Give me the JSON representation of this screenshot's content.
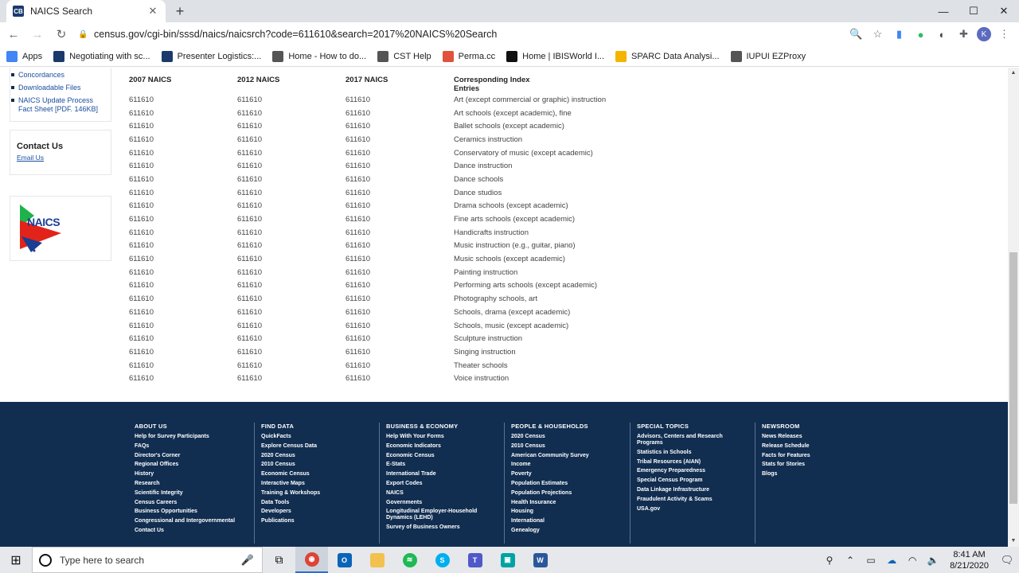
{
  "browser": {
    "tab_title": "NAICS Search",
    "tab_favicon": "CB",
    "url": "census.gov/cgi-bin/sssd/naics/naicsrch?code=611610&search=2017%20NAICS%20Search",
    "profile_initial": "K"
  },
  "bookmarks": [
    {
      "label": "Apps",
      "icon": "apps-grid-icon",
      "color": "#4285f4"
    },
    {
      "label": "Negotiating with sc...",
      "icon": "osc-icon",
      "color": "#1b3a6b"
    },
    {
      "label": "Presenter Logistics:...",
      "icon": "presenter-icon",
      "color": "#1b3a6b"
    },
    {
      "label": "Home - How to do...",
      "icon": "home-icon",
      "color": "#555555"
    },
    {
      "label": "CST Help",
      "icon": "globe-icon",
      "color": "#555555"
    },
    {
      "label": "Perma.cc",
      "icon": "perma-icon",
      "color": "#e0533a"
    },
    {
      "label": "Home | IBISWorld I...",
      "icon": "ibis-icon",
      "color": "#111111"
    },
    {
      "label": "SPARC Data Analysi...",
      "icon": "drive-icon",
      "color": "#f4b400"
    },
    {
      "label": "IUPUI EZProxy",
      "icon": "globe-icon",
      "color": "#555555"
    }
  ],
  "sidebar": {
    "links": [
      "Concordances",
      "Downloadable Files",
      "NAICS Update Process Fact Sheet [PDF. 146KB]"
    ],
    "contact_title": "Contact Us",
    "contact_link": "Email Us",
    "logo_text": "NAICS"
  },
  "table": {
    "headers": [
      "2007 NAICS",
      "2012 NAICS",
      "2017 NAICS",
      "Corresponding Index Entries"
    ],
    "rows": [
      [
        "611610",
        "611610",
        "611610",
        "Art (except commercial or graphic) instruction"
      ],
      [
        "611610",
        "611610",
        "611610",
        "Art schools (except academic), fine"
      ],
      [
        "611610",
        "611610",
        "611610",
        "Ballet schools (except academic)"
      ],
      [
        "611610",
        "611610",
        "611610",
        "Ceramics instruction"
      ],
      [
        "611610",
        "611610",
        "611610",
        "Conservatory of music (except academic)"
      ],
      [
        "611610",
        "611610",
        "611610",
        "Dance instruction"
      ],
      [
        "611610",
        "611610",
        "611610",
        "Dance schools"
      ],
      [
        "611610",
        "611610",
        "611610",
        "Dance studios"
      ],
      [
        "611610",
        "611610",
        "611610",
        "Drama schools (except academic)"
      ],
      [
        "611610",
        "611610",
        "611610",
        "Fine arts schools (except academic)"
      ],
      [
        "611610",
        "611610",
        "611610",
        "Handicrafts instruction"
      ],
      [
        "611610",
        "611610",
        "611610",
        "Music instruction (e.g., guitar, piano)"
      ],
      [
        "611610",
        "611610",
        "611610",
        "Music schools (except academic)"
      ],
      [
        "611610",
        "611610",
        "611610",
        "Painting instruction"
      ],
      [
        "611610",
        "611610",
        "611610",
        "Performing arts schools (except academic)"
      ],
      [
        "611610",
        "611610",
        "611610",
        "Photography schools, art"
      ],
      [
        "611610",
        "611610",
        "611610",
        "Schools, drama (except academic)"
      ],
      [
        "611610",
        "611610",
        "611610",
        "Schools, music (except academic)"
      ],
      [
        "611610",
        "611610",
        "611610",
        "Sculpture instruction"
      ],
      [
        "611610",
        "611610",
        "611610",
        "Singing instruction"
      ],
      [
        "611610",
        "611610",
        "611610",
        "Theater schools"
      ],
      [
        "611610",
        "611610",
        "611610",
        "Voice instruction"
      ]
    ]
  },
  "footer": {
    "columns": [
      {
        "heading": "ABOUT US",
        "links": [
          "Help for Survey Participants",
          "FAQs",
          "Director's Corner",
          "Regional Offices",
          "History",
          "Research",
          "Scientific Integrity",
          "Census Careers",
          "Business Opportunities",
          "Congressional and Intergovernmental",
          "Contact Us"
        ]
      },
      {
        "heading": "FIND DATA",
        "links": [
          "QuickFacts",
          "Explore Census Data",
          "2020 Census",
          "2010 Census",
          "Economic Census",
          "Interactive Maps",
          "Training & Workshops",
          "Data Tools",
          "Developers",
          "Publications"
        ]
      },
      {
        "heading": "BUSINESS & ECONOMY",
        "links": [
          "Help With Your Forms",
          "Economic Indicators",
          "Economic Census",
          "E-Stats",
          "International Trade",
          "Export Codes",
          "NAICS",
          "Governments",
          "Longitudinal Employer-Household Dynamics (LEHD)",
          "Survey of Business Owners"
        ]
      },
      {
        "heading": "PEOPLE & HOUSEHOLDS",
        "links": [
          "2020 Census",
          "2010 Census",
          "American Community Survey",
          "Income",
          "Poverty",
          "Population Estimates",
          "Population Projections",
          "Health Insurance",
          "Housing",
          "International",
          "Genealogy"
        ]
      },
      {
        "heading": "SPECIAL TOPICS",
        "links": [
          "Advisors, Centers and Research Programs",
          "Statistics in Schools",
          "Tribal Resources (AIAN)",
          "Emergency Preparedness",
          "Special Census Program",
          "Data Linkage Infrastructure",
          "Fraudulent Activity & Scams",
          "USA.gov"
        ]
      },
      {
        "heading": "NEWSROOM",
        "links": [
          "News Releases",
          "Release Schedule",
          "Facts for Features",
          "Stats for Stories",
          "Blogs"
        ]
      }
    ]
  },
  "taskbar": {
    "search_placeholder": "Type here to search",
    "time": "8:41 AM",
    "date": "8/21/2020"
  }
}
